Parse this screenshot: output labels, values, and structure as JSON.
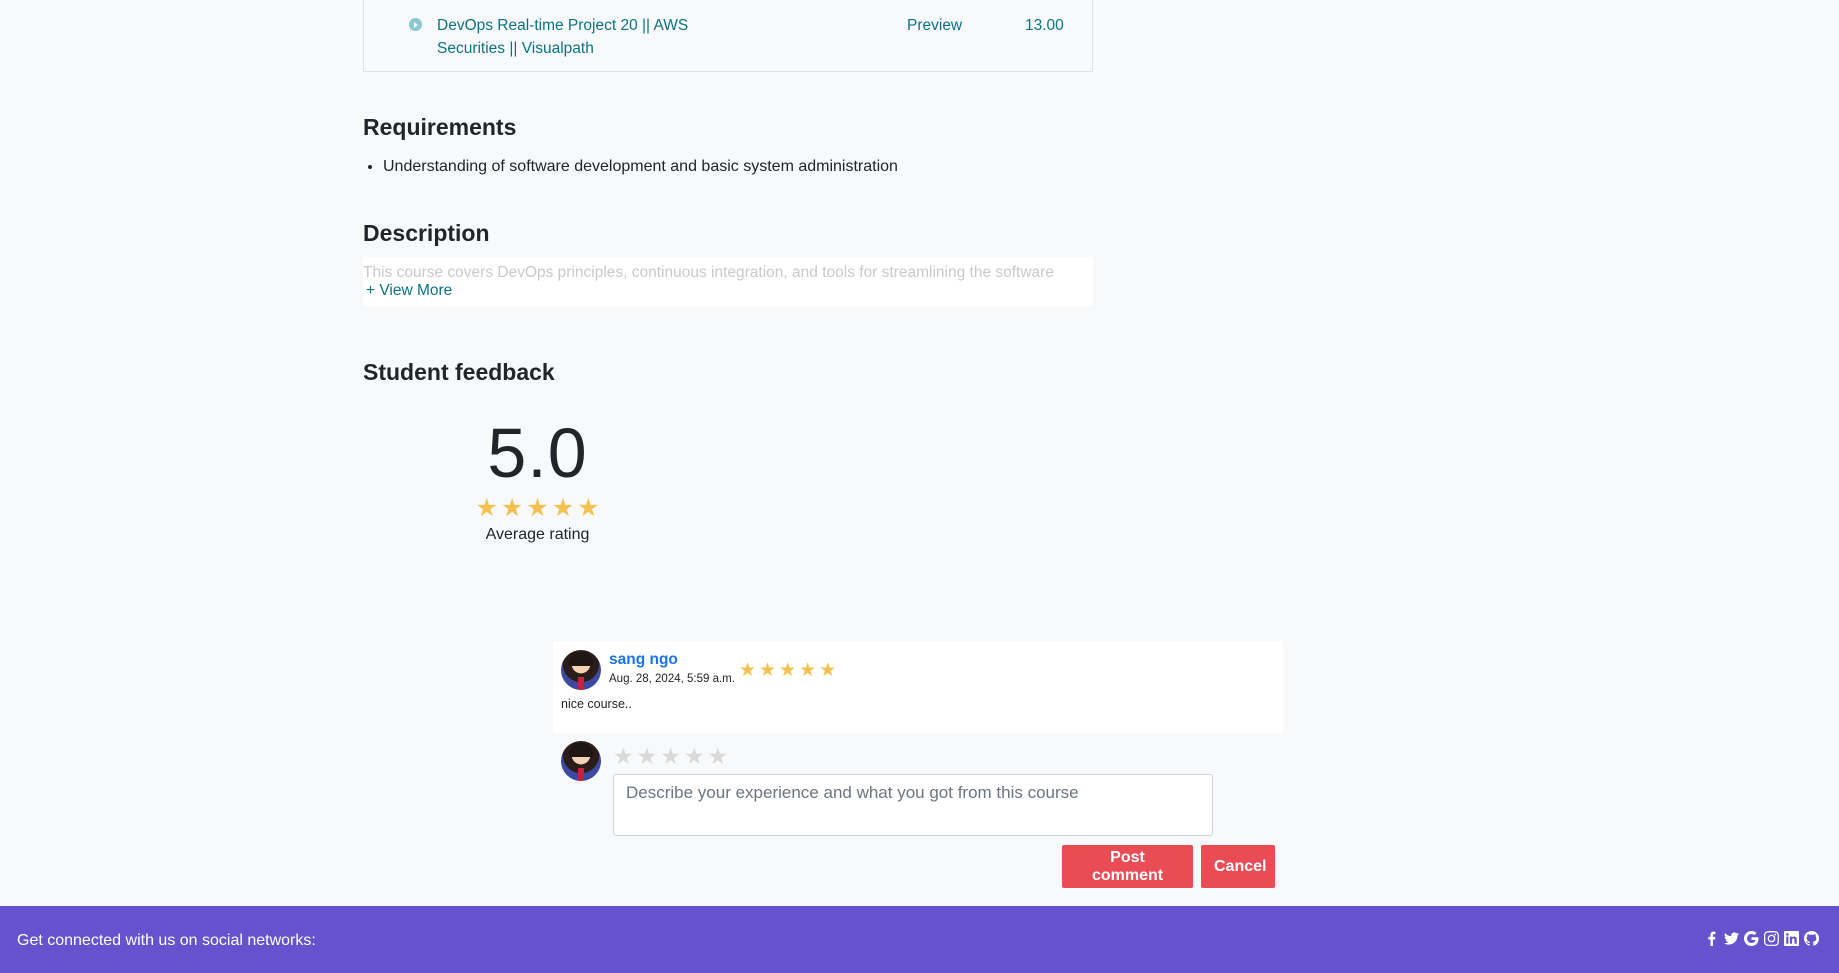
{
  "curriculum": {
    "lecture": {
      "title": "DevOps Real-time Project 20 || AWS Securities || Visualpath",
      "preview_label": "Preview",
      "duration": "13.00"
    }
  },
  "requirements": {
    "heading": "Requirements",
    "items": [
      "Understanding of software development and basic system administration"
    ]
  },
  "description": {
    "heading": "Description",
    "text": "This course covers DevOps principles, continuous integration, and tools for streamlining the software",
    "view_more_label": "+ View More"
  },
  "feedback": {
    "heading": "Student feedback",
    "average_rating": "5.0",
    "average_rating_value": 5,
    "average_label": "Average rating"
  },
  "reviews": [
    {
      "name": "sang ngo",
      "date": "Aug. 28, 2024, 5:59 a.m.",
      "rating": 5,
      "text": "nice course.."
    }
  ],
  "comment_form": {
    "rating": 0,
    "placeholder": "Describe your experience and what you got from this course",
    "post_label": "Post comment",
    "cancel_label": "Cancel"
  },
  "footer": {
    "text": "Get connected with us on social networks:",
    "social_icons": [
      "facebook-icon",
      "twitter-icon",
      "google-icon",
      "instagram-icon",
      "linkedin-icon",
      "github-icon"
    ]
  },
  "colors": {
    "accent_link": "#0b7285",
    "star": "#f4c150",
    "button": "#ea4c56",
    "footer": "#6652cc",
    "reviewer_name": "#1a73e8"
  }
}
